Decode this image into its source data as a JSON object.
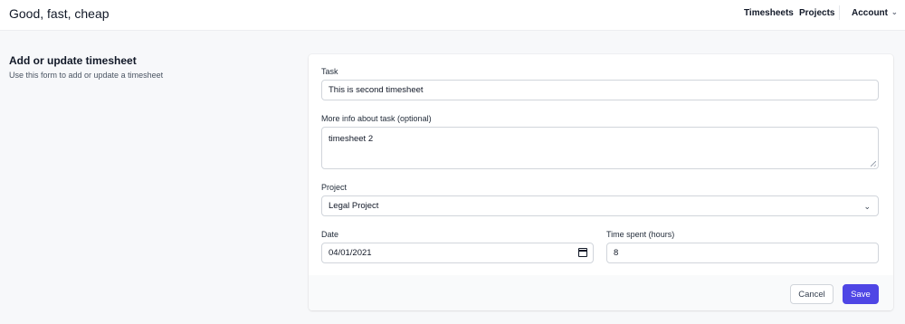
{
  "header": {
    "brand": "Good, fast, cheap",
    "nav": {
      "timesheets": "Timesheets",
      "projects": "Projects",
      "account": "Account"
    }
  },
  "section": {
    "title": "Add or update timesheet",
    "description": "Use this form to add or update a timesheet"
  },
  "form": {
    "task": {
      "label": "Task",
      "value": "This is second timesheet"
    },
    "more_info": {
      "label": "More info about task (optional)",
      "value": "timesheet 2"
    },
    "project": {
      "label": "Project",
      "value": "Legal Project"
    },
    "date": {
      "label": "Date",
      "value": "04/01/2021"
    },
    "time_spent": {
      "label": "Time spent (hours)",
      "value": "8"
    },
    "cancel_label": "Cancel",
    "save_label": "Save"
  },
  "icons": {
    "select": "chevron-down-icon",
    "date": "calendar-icon",
    "account": "chevron-down-icon"
  },
  "colors": {
    "primary": "#4f46e5",
    "background": "#f7f8fa"
  }
}
